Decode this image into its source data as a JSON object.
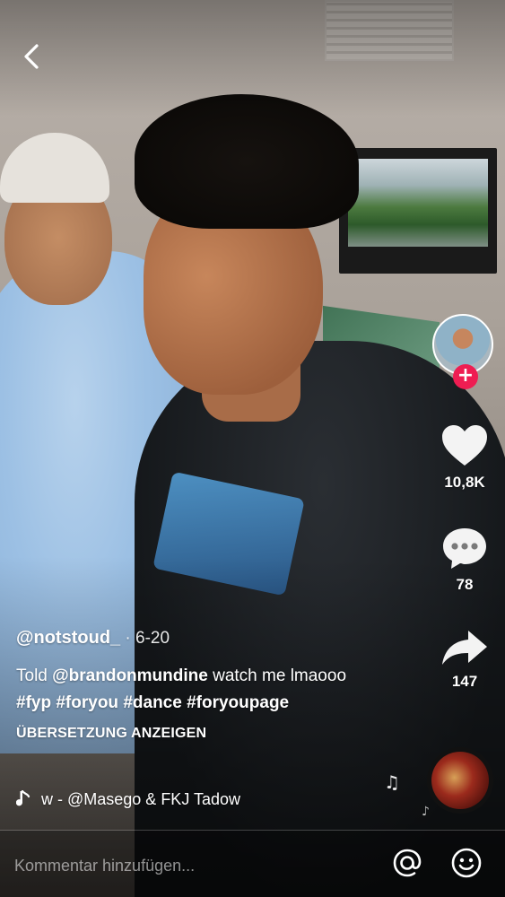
{
  "post": {
    "username": "@notstoud_",
    "date": " · 6-20",
    "caption": {
      "pre": "Told ",
      "mention": "@brandonmundine",
      "mid": " watch me lmaooo ",
      "tags": [
        "#fyp",
        "#foryou",
        "#dance",
        "#foryoupage"
      ]
    },
    "translate_label": "ÜBERSETZUNG ANZEIGEN",
    "music": "w - @Masego & FKJ     Tadow"
  },
  "actions": {
    "likes": "10,8K",
    "comments": "78",
    "shares": "147"
  },
  "comment_bar": {
    "placeholder": "Kommentar hinzufügen..."
  },
  "icons": {
    "back": "chevron-left-icon",
    "like": "heart-icon",
    "comment": "speech-bubble-icon",
    "share": "share-arrow-icon",
    "music": "music-note-icon",
    "mention": "at-sign-icon",
    "emoji": "smiley-icon"
  },
  "colors": {
    "follow_accent": "#ee1d52",
    "text": "#ffffff"
  }
}
